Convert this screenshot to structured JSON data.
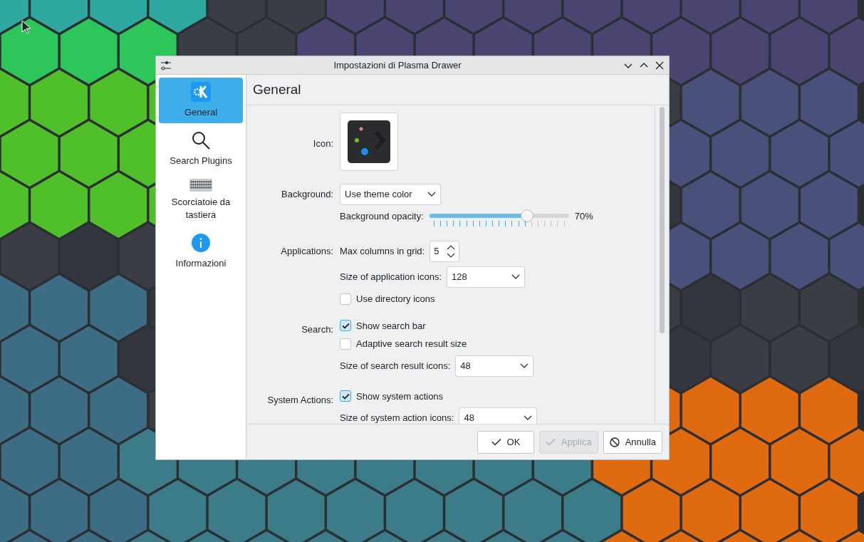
{
  "window": {
    "title": "Impostazioni di Plasma Drawer"
  },
  "sidebar": {
    "items": [
      {
        "label": "General",
        "selected": true
      },
      {
        "label": "Search Plugins",
        "selected": false
      },
      {
        "label": "Scorciatoie da tastiera",
        "selected": false
      },
      {
        "label": "Informazioni",
        "selected": false
      }
    ]
  },
  "page": {
    "title": "General"
  },
  "sections": [
    {
      "label": "Icon:",
      "items": [
        {
          "kind": "icon"
        }
      ]
    },
    {
      "label": "Background:",
      "items": [
        {
          "kind": "select",
          "value": "Use theme color"
        },
        {
          "kind": "slider",
          "label": "Background opacity:",
          "level": 0.7,
          "reading": "70%"
        }
      ]
    },
    {
      "label": "Applications:",
      "items": [
        {
          "kind": "spin",
          "label": "Max columns in grid:",
          "value": "5"
        },
        {
          "kind": "select",
          "label": "Size of application icons:",
          "value": "128"
        },
        {
          "kind": "checkbox",
          "label": "Use directory icons",
          "checked": false
        }
      ]
    },
    {
      "label": "Search:",
      "items": [
        {
          "kind": "checkbox",
          "label": "Show search bar",
          "checked": true
        },
        {
          "kind": "checkbox",
          "label": "Adaptive search result size",
          "checked": false
        },
        {
          "kind": "select",
          "label": "Size of search result icons:",
          "value": "48"
        }
      ]
    },
    {
      "label": "System Actions:",
      "items": [
        {
          "kind": "checkbox",
          "label": "Show system actions",
          "checked": true
        },
        {
          "kind": "select",
          "label": "Size of system action icons:",
          "value": "48"
        }
      ]
    }
  ],
  "buttons": [
    {
      "label": "OK",
      "disabled": false
    },
    {
      "label": "Applica",
      "disabled": true
    },
    {
      "label": "Annulla",
      "disabled": false
    }
  ]
}
